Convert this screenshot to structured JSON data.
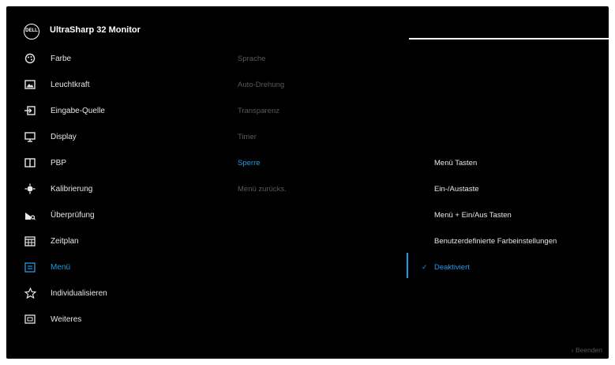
{
  "header": {
    "brand_logo_text": "DELL",
    "title": "UltraSharp 32 Monitor"
  },
  "main_menu": [
    {
      "label": "Farbe",
      "icon": "color-palette-icon"
    },
    {
      "label": "Leuchtkraft",
      "icon": "brightness-icon"
    },
    {
      "label": "Eingabe-Quelle",
      "icon": "input-source-icon"
    },
    {
      "label": "Display",
      "icon": "display-icon"
    },
    {
      "label": "PBP",
      "icon": "pbp-icon"
    },
    {
      "label": "Kalibrierung",
      "icon": "calibration-icon"
    },
    {
      "label": "Überprüfung",
      "icon": "validation-icon"
    },
    {
      "label": "Zeitplan",
      "icon": "schedule-icon"
    },
    {
      "label": "Menü",
      "icon": "menu-icon",
      "active": true
    },
    {
      "label": "Individualisieren",
      "icon": "star-icon"
    },
    {
      "label": "Weiteres",
      "icon": "others-icon"
    }
  ],
  "submenu": [
    {
      "label": "Sprache"
    },
    {
      "label": "Auto-Drehung"
    },
    {
      "label": "Transparenz"
    },
    {
      "label": "Timer"
    },
    {
      "label": "Sperre",
      "active": true
    },
    {
      "label": "Menü zurücks."
    }
  ],
  "options": [
    {
      "label": "Menü Tasten"
    },
    {
      "label": "Ein-/Austaste"
    },
    {
      "label": "Menü + Ein/Aus Tasten"
    },
    {
      "label": "Benutzerdefinierte Farbeinstellungen"
    },
    {
      "label": "Deaktiviert",
      "selected": true
    }
  ],
  "footer": {
    "exit_label": "‹ Beenden"
  },
  "colors": {
    "accent": "#1e9be6",
    "background": "#000000",
    "text": "#e6e6e6",
    "dim_text": "#595959"
  }
}
